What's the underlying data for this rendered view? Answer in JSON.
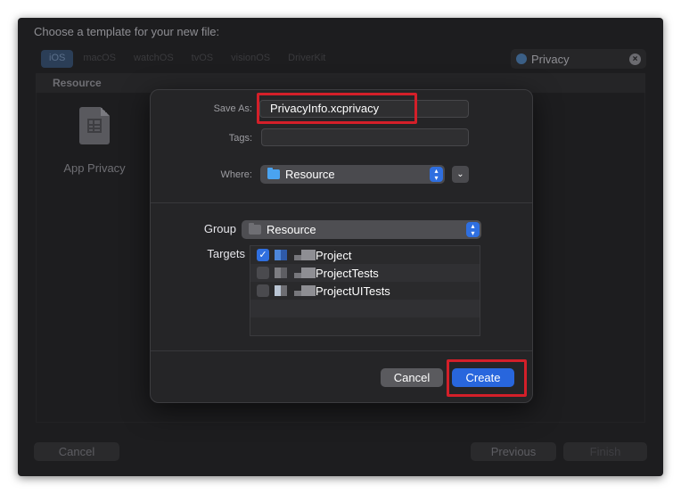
{
  "window": {
    "title": "Choose a template for your new file:",
    "platform_tabs": [
      "iOS",
      "macOS",
      "watchOS",
      "tvOS",
      "visionOS",
      "DriverKit"
    ],
    "active_tab": "iOS",
    "search_value": "Privacy",
    "section_header": "Resource",
    "template_label": "App Privacy",
    "buttons": {
      "cancel": "Cancel",
      "previous": "Previous",
      "finish": "Finish"
    }
  },
  "sheet": {
    "save_as_label": "Save As:",
    "save_as_value": "PrivacyInfo.xcprivacy",
    "tags_label": "Tags:",
    "tags_value": "",
    "where_label": "Where:",
    "where_value": "Resource",
    "group_label": "Group",
    "group_value": "Resource",
    "targets_label": "Targets",
    "targets": [
      {
        "name": "Project",
        "checked": true
      },
      {
        "name": "ProjectTests",
        "checked": false
      },
      {
        "name": "ProjectUITests",
        "checked": false
      }
    ],
    "cancel_label": "Cancel",
    "create_label": "Create"
  },
  "colors": {
    "highlight_border": "#d41f29",
    "accent_blue": "#2866dd",
    "window_bg": "#1d1d1f",
    "sheet_bg": "#252527"
  },
  "icons": [
    "search-icon",
    "clear-icon",
    "app-privacy-file-icon",
    "folder-icon",
    "chevron-updown-icon",
    "chevron-down-icon",
    "checkmark-icon",
    "target-icon"
  ]
}
